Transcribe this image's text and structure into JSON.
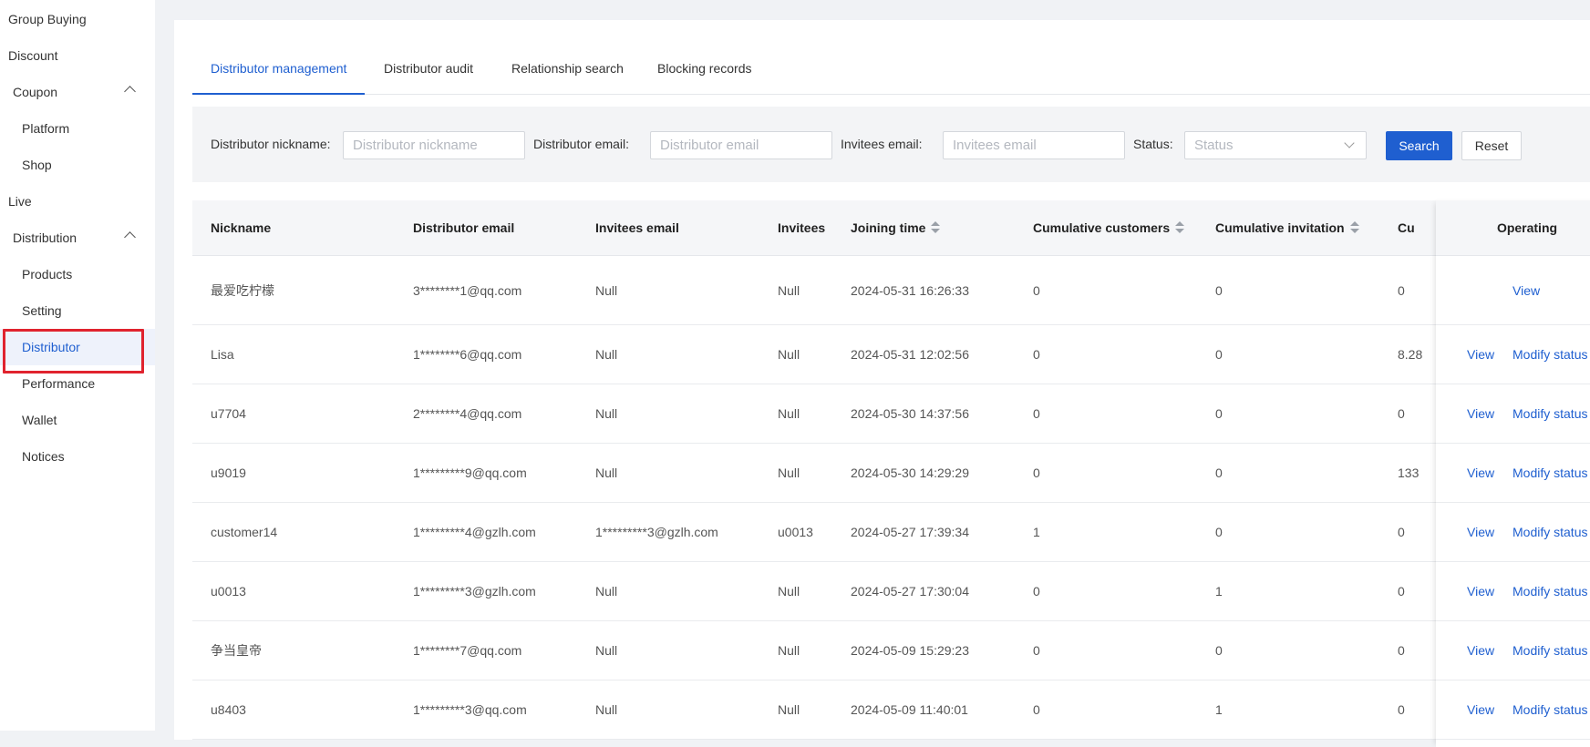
{
  "sidebar": {
    "items": [
      {
        "label": "Group Buying"
      },
      {
        "label": "Discount"
      },
      {
        "label": "Coupon"
      },
      {
        "label": "Platform"
      },
      {
        "label": "Shop"
      },
      {
        "label": "Live"
      },
      {
        "label": "Distribution"
      },
      {
        "label": "Products"
      },
      {
        "label": "Setting"
      },
      {
        "label": "Distributor"
      },
      {
        "label": "Performance"
      },
      {
        "label": "Wallet"
      },
      {
        "label": "Notices"
      }
    ]
  },
  "tabs": [
    {
      "label": "Distributor management"
    },
    {
      "label": "Distributor audit"
    },
    {
      "label": "Relationship search"
    },
    {
      "label": "Blocking records"
    }
  ],
  "filters": {
    "nickname_label": "Distributor nickname:",
    "nickname_placeholder": "Distributor nickname",
    "email_label": "Distributor email:",
    "email_placeholder": "Distributor email",
    "invitees_label": "Invitees email:",
    "invitees_placeholder": "Invitees email",
    "status_label": "Status:",
    "status_placeholder": "Status",
    "search_label": "Search",
    "reset_label": "Reset"
  },
  "table": {
    "columns": [
      "Nickname",
      "Distributor email",
      "Invitees email",
      "Invitees",
      "Joining time",
      "Cumulative customers",
      "Cumulative invitation",
      "Cu",
      "Operating"
    ],
    "rows": [
      {
        "nickname": "最爱吃柠檬",
        "email": "3********1@qq.com",
        "invitees_email": "Null",
        "invitees": "Null",
        "joining": "2024-05-31 16:26:33",
        "customers": "0",
        "invitation": "0",
        "cu": "0",
        "view": "View",
        "modify": ""
      },
      {
        "nickname": "Lisa",
        "email": "1********6@qq.com",
        "invitees_email": "Null",
        "invitees": "Null",
        "joining": "2024-05-31 12:02:56",
        "customers": "0",
        "invitation": "0",
        "cu": "8.28",
        "view": "View",
        "modify": "Modify status"
      },
      {
        "nickname": "u7704",
        "email": "2********4@qq.com",
        "invitees_email": "Null",
        "invitees": "Null",
        "joining": "2024-05-30 14:37:56",
        "customers": "0",
        "invitation": "0",
        "cu": "0",
        "view": "View",
        "modify": "Modify status"
      },
      {
        "nickname": "u9019",
        "email": "1*********9@qq.com",
        "invitees_email": "Null",
        "invitees": "Null",
        "joining": "2024-05-30 14:29:29",
        "customers": "0",
        "invitation": "0",
        "cu": "133",
        "view": "View",
        "modify": "Modify status"
      },
      {
        "nickname": "customer14",
        "email": "1*********4@gzlh.com",
        "invitees_email": "1*********3@gzlh.com",
        "invitees": "u0013",
        "joining": "2024-05-27 17:39:34",
        "customers": "1",
        "invitation": "0",
        "cu": "0",
        "view": "View",
        "modify": "Modify status"
      },
      {
        "nickname": "u0013",
        "email": "1*********3@gzlh.com",
        "invitees_email": "Null",
        "invitees": "Null",
        "joining": "2024-05-27 17:30:04",
        "customers": "0",
        "invitation": "1",
        "cu": "0",
        "view": "View",
        "modify": "Modify status"
      },
      {
        "nickname": "争当皇帝",
        "email": "1********7@qq.com",
        "invitees_email": "Null",
        "invitees": "Null",
        "joining": "2024-05-09 15:29:23",
        "customers": "0",
        "invitation": "0",
        "cu": "0",
        "view": "View",
        "modify": "Modify status"
      },
      {
        "nickname": "u8403",
        "email": "1*********3@qq.com",
        "invitees_email": "Null",
        "invitees": "Null",
        "joining": "2024-05-09 11:40:01",
        "customers": "0",
        "invitation": "1",
        "cu": "0",
        "view": "View",
        "modify": "Modify status"
      }
    ]
  }
}
